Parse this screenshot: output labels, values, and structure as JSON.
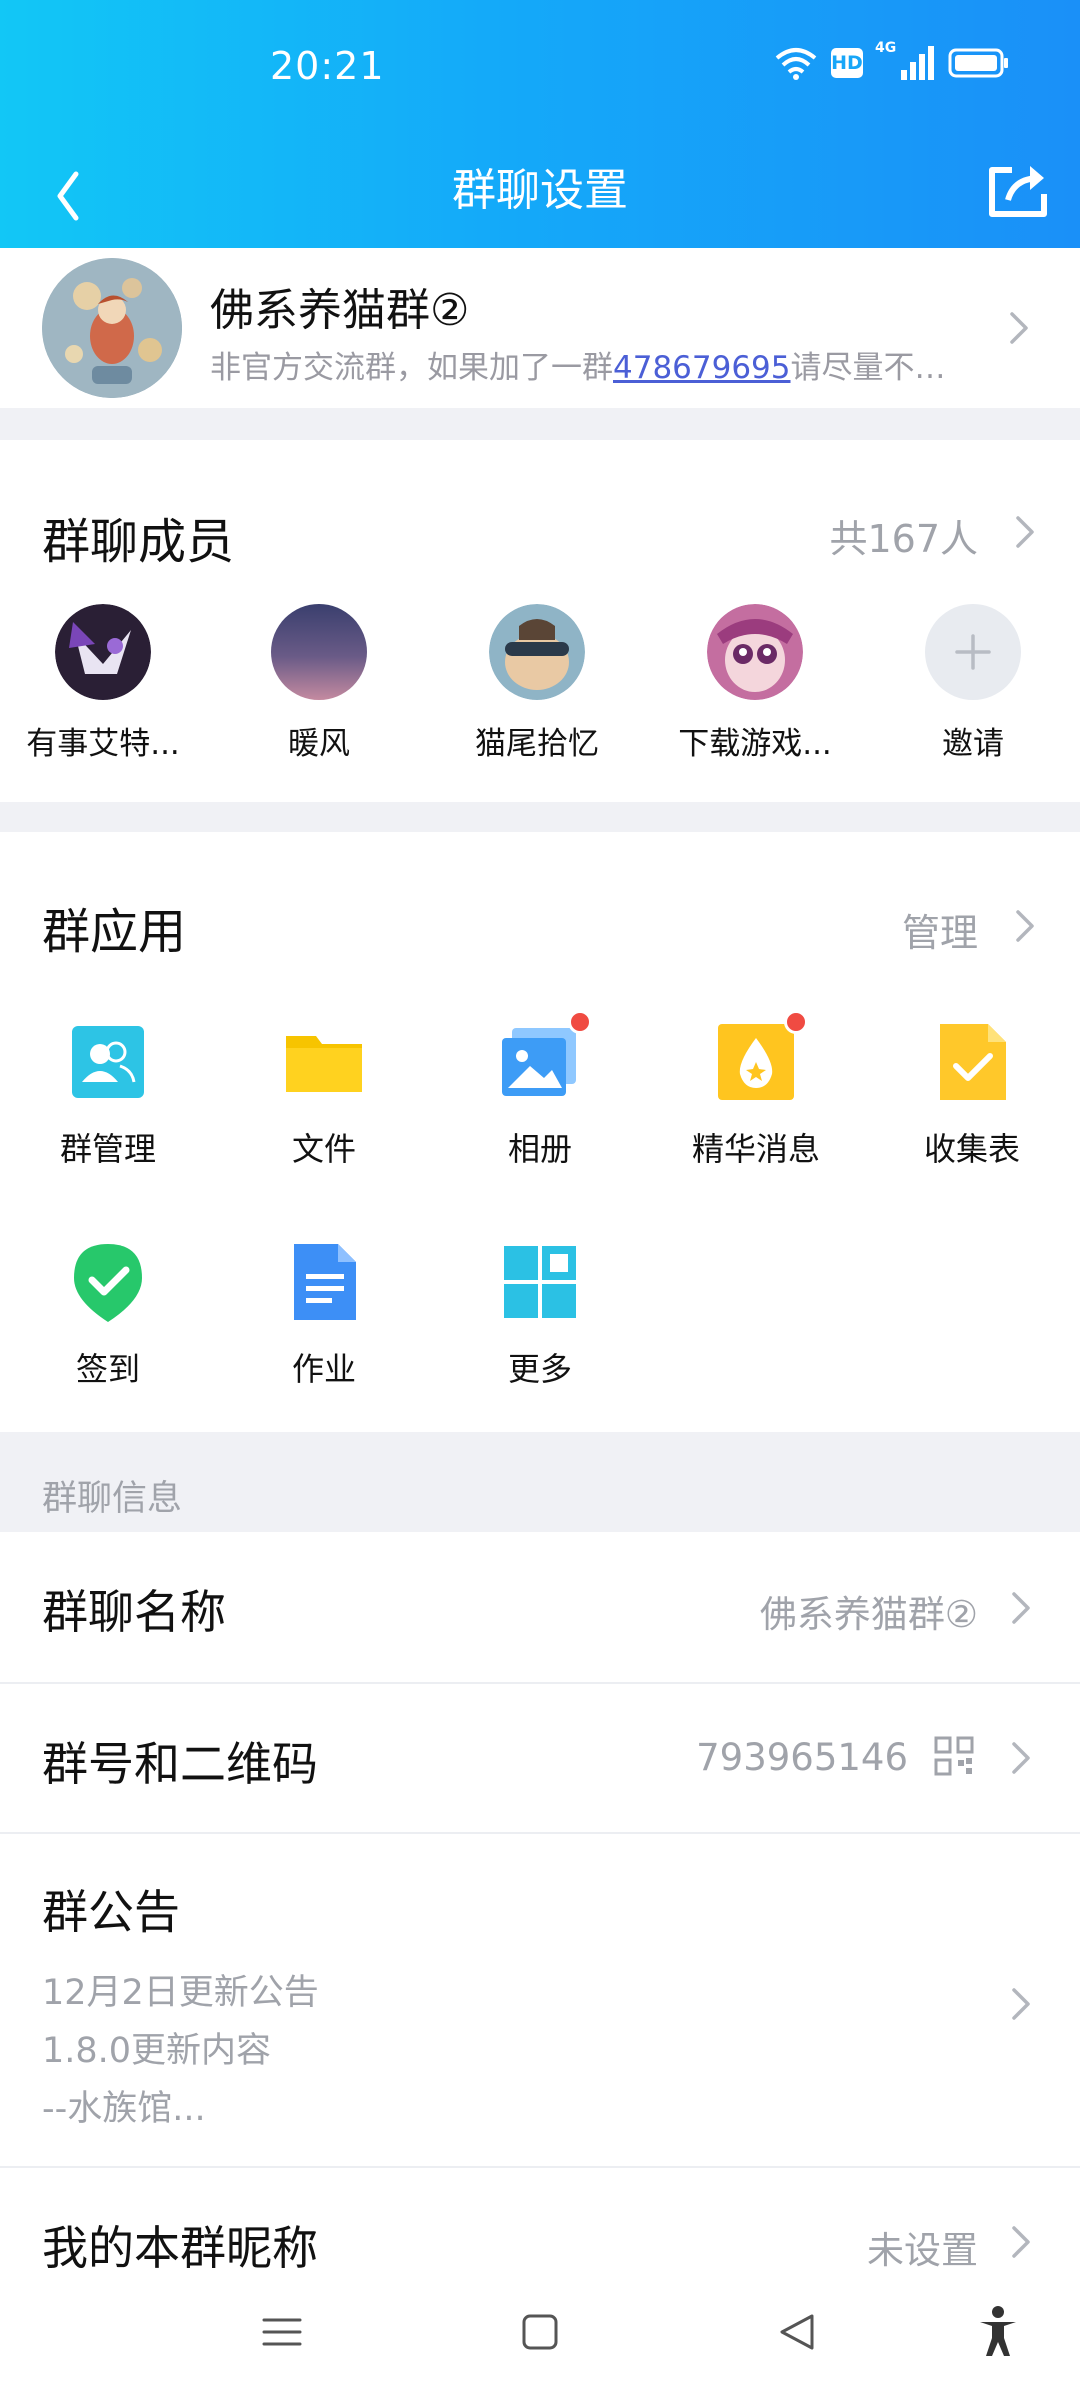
{
  "status_bar": {
    "time": "20:21",
    "net_type": "HD",
    "signal_label": "4G"
  },
  "nav": {
    "title": "群聊设置"
  },
  "group": {
    "name": "佛系养猫群②",
    "desc_prefix": "非官方交流群，如果加了一群",
    "desc_link": "478679695",
    "desc_suffix": "请尽量不要..."
  },
  "members": {
    "title": "群聊成员",
    "count": "共167人",
    "list": [
      {
        "name": "有事艾特..."
      },
      {
        "name": "暖风"
      },
      {
        "name": "猫尾拾忆"
      },
      {
        "name": "下载游戏..."
      },
      {
        "name": "邀请"
      }
    ]
  },
  "apps": {
    "title": "群应用",
    "manage": "管理",
    "items": [
      {
        "label": "群管理",
        "icon": "group-manage-icon"
      },
      {
        "label": "文件",
        "icon": "folder-icon"
      },
      {
        "label": "相册",
        "icon": "album-icon"
      },
      {
        "label": "精华消息",
        "icon": "essence-icon"
      },
      {
        "label": "收集表",
        "icon": "collect-form-icon"
      },
      {
        "label": "签到",
        "icon": "check-in-icon"
      },
      {
        "label": "作业",
        "icon": "homework-icon"
      },
      {
        "label": "更多",
        "icon": "more-icon"
      }
    ]
  },
  "info": {
    "section_label": "群聊信息",
    "name_label": "群聊名称",
    "name_value": "佛系养猫群②",
    "number_label": "群号和二维码",
    "number_value": "793965146",
    "notice_label": "群公告",
    "notice_lines": [
      "12月2日更新公告",
      "1.8.0更新内容",
      "--水族馆..."
    ],
    "nickname_label": "我的本群昵称",
    "nickname_value": "未设置"
  },
  "colors": {
    "header_start": "#12c7f6",
    "header_end": "#1a90f8",
    "badge": "#f04b42",
    "link": "#4b5fd6"
  }
}
